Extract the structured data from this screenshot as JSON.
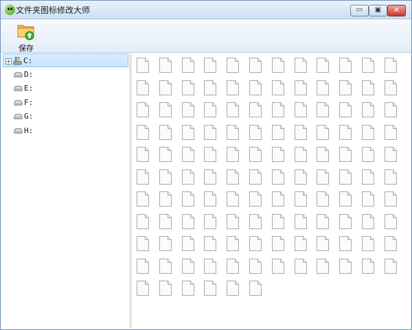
{
  "window": {
    "title": "文件夹图标修改大师",
    "controls": {
      "minimize": "▭",
      "maximize": "▣",
      "close": "✕"
    }
  },
  "toolbar": {
    "save_label": "保存",
    "save_icon": "folder-save-icon"
  },
  "tree": {
    "items": [
      {
        "label": "C:",
        "icon": "system-drive-icon",
        "expandable": true,
        "selected": true
      },
      {
        "label": "D:",
        "icon": "drive-icon",
        "expandable": false,
        "selected": false
      },
      {
        "label": "E:",
        "icon": "drive-icon",
        "expandable": false,
        "selected": false
      },
      {
        "label": "F:",
        "icon": "drive-icon",
        "expandable": false,
        "selected": false
      },
      {
        "label": "G:",
        "icon": "drive-icon",
        "expandable": false,
        "selected": false
      },
      {
        "label": "H:",
        "icon": "drive-icon",
        "expandable": false,
        "selected": false
      }
    ]
  },
  "icon_grid": {
    "icon": "blank-file-icon",
    "count": 126
  },
  "colors": {
    "selection": "#c6e6fb",
    "selection_border": "#8ac8ef",
    "title_gradient": "#cfe0f3",
    "close_button": "#c6392a"
  }
}
